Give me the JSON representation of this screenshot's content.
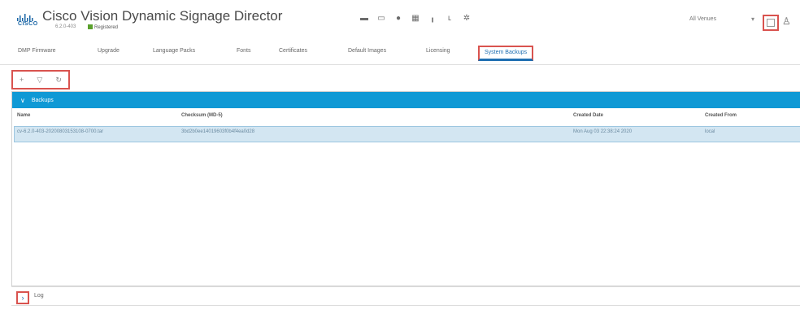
{
  "header": {
    "logo_text": "CISCO",
    "app_title": "Cisco Vision Dynamic Signage Director",
    "version": "6.2.0-403",
    "registration": "Registered",
    "toolbar_icons": [
      "folder-icon",
      "display-icon",
      "gear-icon",
      "grid-icon",
      "chart-icon",
      "flow-icon",
      "settings-icon"
    ],
    "venue_select": "All Venues",
    "colors": {
      "accent": "#0f99d5",
      "highlight": "#d9534f",
      "registered": "#5aa02c"
    }
  },
  "tabs": [
    "DMP Firmware",
    "Upgrade",
    "Language Packs",
    "Fonts",
    "Certificates",
    "Default Images",
    "Licensing",
    "System Backups"
  ],
  "active_tab": "System Backups",
  "backups": {
    "title": "Backups",
    "columns": [
      "Name",
      "Checksum (MD-5)",
      "Created Date",
      "Created From"
    ],
    "rows": [
      {
        "name": "cv-6.2.0-403-20200803153108-0700.tar",
        "checksum": "3bd2b0ee14019603f0b4f4ea0d28",
        "created_date": "Mon Aug 03 22:38:24 2020",
        "created_from": "local"
      }
    ]
  },
  "log": {
    "label": "Log"
  }
}
